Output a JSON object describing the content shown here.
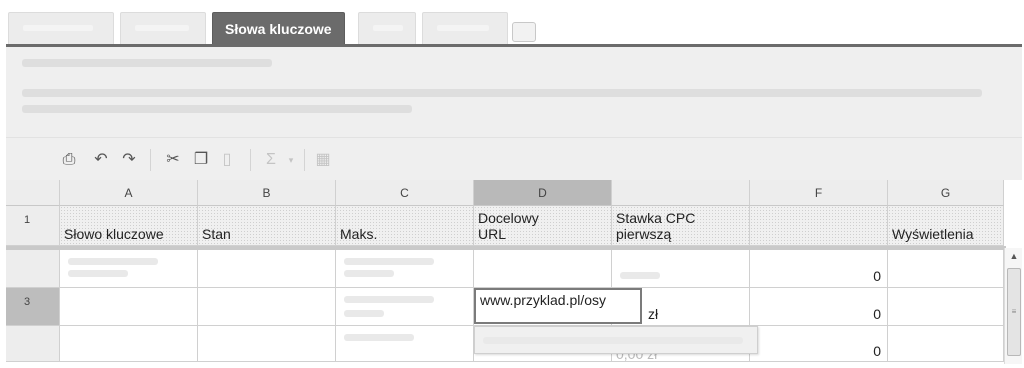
{
  "tabs": [
    {
      "label": "",
      "active": false
    },
    {
      "label": "",
      "active": false
    },
    {
      "label": "Słowa kluczowe",
      "active": true
    },
    {
      "label": "",
      "active": false
    },
    {
      "label": "",
      "active": false
    }
  ],
  "toolbar": {
    "icons": [
      "print-icon",
      "undo-icon",
      "redo-icon",
      "cut-icon",
      "copy-icon",
      "paste-icon",
      "sum-icon",
      "chart-icon"
    ],
    "sum_glyph": "Σ"
  },
  "grid": {
    "columns": [
      "A",
      "B",
      "C",
      "D",
      "",
      "F",
      "G"
    ],
    "header_row_number": "1",
    "headers": {
      "a": "Słowo kluczowe",
      "b": "Stan",
      "c": "Maks.",
      "d": "Docelowy\nURL",
      "e": "Stawka CPC\npierwszą",
      "f": "",
      "g": "Wyświetlenia"
    },
    "rows": [
      {
        "row_number": "",
        "f": "0"
      },
      {
        "row_number": "3",
        "e": "zł",
        "f": "0"
      },
      {
        "row_number": "",
        "e": "0,00 zł",
        "f": "0"
      }
    ],
    "editing_value": "www.przyklad.pl/osy"
  }
}
